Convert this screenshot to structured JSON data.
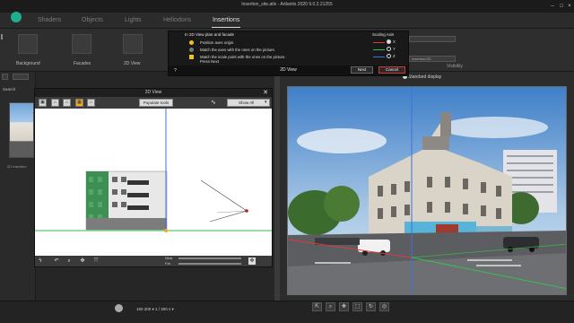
{
  "window": {
    "title": "Insertion_site.atlx - Artlantis 2020 9.0.2.21255"
  },
  "menu": {
    "tabs": [
      {
        "label": "Shaders"
      },
      {
        "label": "Objects"
      },
      {
        "label": "Lights"
      },
      {
        "label": "Heliodons"
      },
      {
        "label": "Insertions"
      }
    ]
  },
  "toolbar": {
    "items": [
      {
        "label": "Background"
      },
      {
        "label": "Facades"
      },
      {
        "label": "2D View"
      }
    ]
  },
  "left": {
    "search_label": "Search",
    "thumb_label": "2D Insertion"
  },
  "wizard": {
    "heading": "In 2D View plan and facade",
    "axis_heading": "Scaling Axis",
    "steps": [
      {
        "text": "Position axes origin.",
        "color": "#f2c218"
      },
      {
        "text": "Match the axes with the ones on the picture.",
        "color": "#777777"
      },
      {
        "text": "Match the scale point with the ones on the picture.",
        "color": "#f2c218"
      },
      {
        "text": "Press Next",
        "color": ""
      }
    ],
    "axes": [
      {
        "name": "X",
        "color": "#e0393e",
        "selected": true
      },
      {
        "name": "Y",
        "color": "#35c24d",
        "selected": false
      },
      {
        "name": "Z",
        "color": "#3f6fe0",
        "selected": false
      }
    ],
    "footer_title": "2D View",
    "help": "?",
    "next_label": "Next",
    "cancel_label": "Cancel"
  },
  "view2d": {
    "title": "2D View",
    "populate_label": "Populate tools",
    "showall_label": "Show All",
    "near_label": "Near",
    "far_label": "Far"
  },
  "right": {
    "standard_display": "Standard display",
    "visibility": "Visibility",
    "combo1": "",
    "combo2": "Insertion/2D"
  },
  "bottom": {
    "zoom_text": "150  200   ▾   1 / 300 s   ▾"
  },
  "colors": {
    "x_axis": "#e0393e",
    "y_axis": "#35c24d",
    "z_axis": "#3f6fe0",
    "accent_yellow": "#f6a623",
    "brand": "#1fae8c"
  }
}
